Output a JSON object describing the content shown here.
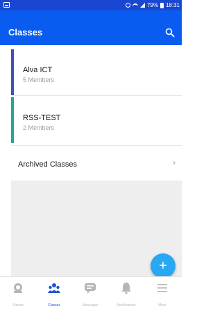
{
  "status_bar": {
    "battery_percent": "79%",
    "time": "18:31"
  },
  "app_bar": {
    "title": "Classes",
    "search_icon": "search-icon"
  },
  "classes": [
    {
      "name": "Alva ICT",
      "members": "5 Members",
      "accent_color": "#3f51b5"
    },
    {
      "name": "RSS-TEST",
      "members": "2 Members",
      "accent_color": "#26a69a"
    }
  ],
  "archived": {
    "label": "Archived Classes",
    "chevron": "›"
  },
  "fab": {
    "icon": "add-icon",
    "symbol": "+",
    "color": "#29a8f2"
  },
  "bottom_nav": [
    {
      "key": "stream",
      "label": "Stream",
      "icon": "stream-icon",
      "active": false
    },
    {
      "key": "classes",
      "label": "Classes",
      "icon": "classes-icon",
      "active": true
    },
    {
      "key": "messages",
      "label": "Messages",
      "icon": "messages-icon",
      "active": false
    },
    {
      "key": "notifications",
      "label": "Notifications",
      "icon": "bell-icon",
      "active": false
    },
    {
      "key": "more",
      "label": "More",
      "icon": "menu-icon",
      "active": false
    }
  ],
  "colors": {
    "app_bar": "#0a5cf0",
    "status_bar": "#1a47d1",
    "active_nav": "#1f53d8"
  }
}
